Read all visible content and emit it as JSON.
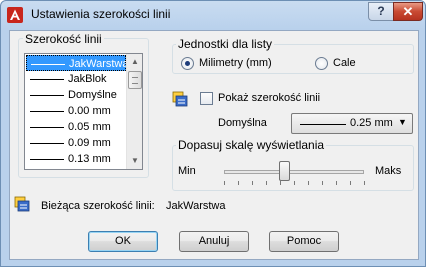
{
  "window": {
    "title": "Ustawienia szerokości linii",
    "help_label": "?",
    "close_label": "✕",
    "app_icon": "autocad-icon"
  },
  "lineweights": {
    "group_title": "Szerokość linii",
    "items": [
      {
        "label": "JakWarstwa",
        "selected": true
      },
      {
        "label": "JakBlok",
        "selected": false
      },
      {
        "label": "Domyślne",
        "selected": false
      },
      {
        "label": "0.00 mm",
        "selected": false
      },
      {
        "label": "0.05 mm",
        "selected": false
      },
      {
        "label": "0.09 mm",
        "selected": false
      },
      {
        "label": "0.13 mm",
        "selected": false
      }
    ]
  },
  "units": {
    "group_title": "Jednostki dla listy",
    "option_mm": "Milimetry (mm)",
    "option_inch": "Cale",
    "selected": "mm"
  },
  "display": {
    "show_label": "Pokaż szerokość linii",
    "show_checked": false,
    "default_label": "Domyślna",
    "default_value": "0.25 mm"
  },
  "scale": {
    "group_title": "Dopasuj skalę wyświetlania",
    "min_label": "Min",
    "max_label": "Maks",
    "position": 0.4
  },
  "current": {
    "label": "Bieżąca szerokość linii:",
    "value": "JakWarstwa"
  },
  "buttons": {
    "ok": "OK",
    "cancel": "Anuluj",
    "help": "Pomoc"
  },
  "colors": {
    "selection": "#3399ff",
    "title_bar": "#b9d1ec",
    "close_button": "#c94a33"
  }
}
